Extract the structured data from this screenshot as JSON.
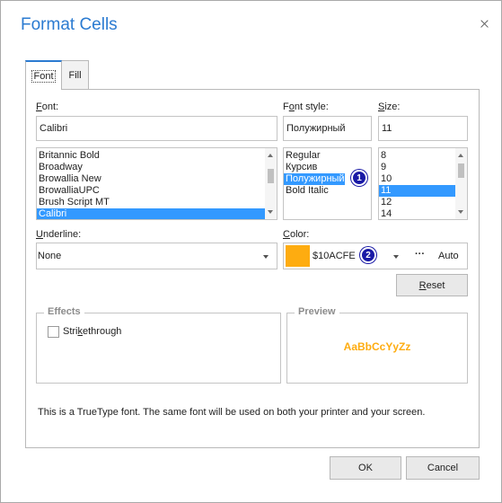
{
  "window": {
    "title": "Format Cells"
  },
  "tabs": [
    {
      "label": "Font",
      "active": true
    },
    {
      "label": "Fill",
      "active": false
    }
  ],
  "font": {
    "label": "Font:",
    "value": "Calibri",
    "list": [
      "Britannic Bold",
      "Broadway",
      "Browallia New",
      "BrowalliaUPC",
      "Brush Script MT",
      "Calibri"
    ],
    "selected": "Calibri"
  },
  "font_style": {
    "label": "Font style:",
    "value": "Полужирный",
    "list": [
      "Regular",
      "Курсив",
      "Полужирный",
      "Bold Italic"
    ],
    "selected": "Полужирный"
  },
  "size": {
    "label": "Size:",
    "value": "11",
    "list": [
      "8",
      "9",
      "10",
      "11",
      "12",
      "14"
    ],
    "selected": "11"
  },
  "underline": {
    "label": "Underline:",
    "value": "None"
  },
  "color": {
    "label": "Color:",
    "swatch": "#FEAC10",
    "value": "$10ACFE",
    "more": "···",
    "auto": "Auto"
  },
  "reset_label": "Reset",
  "effects": {
    "title": "Effects",
    "strikethrough_label": "Strikethrough",
    "strikethrough_checked": false
  },
  "preview": {
    "title": "Preview",
    "sample": "AaBbCcYyZz",
    "color": "#FEAC10"
  },
  "info_text": "This is a TrueType font. The same font will be used on both your printer and your screen.",
  "buttons": {
    "ok": "OK",
    "cancel": "Cancel"
  },
  "badges": {
    "one": "1",
    "two": "2"
  },
  "accent": "#2B7BD1"
}
